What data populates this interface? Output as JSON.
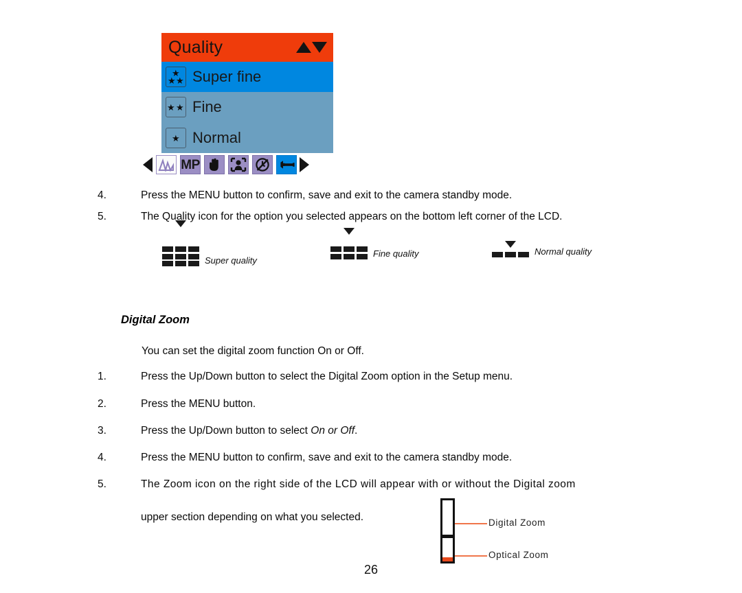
{
  "lcd_menu": {
    "title": "Quality",
    "header_color": "#EF3C0B",
    "selected_color": "#0087E0",
    "body_color": "#6B9FC0",
    "scroll_up_icon": "triangle-up-icon",
    "scroll_down_icon": "triangle-down-icon",
    "options": [
      {
        "label": "Super fine",
        "stars": 3,
        "selected": true
      },
      {
        "label": "Fine",
        "stars": 2,
        "selected": false
      },
      {
        "label": "Normal",
        "stars": 1,
        "selected": false
      }
    ]
  },
  "mode_toolbar": {
    "prev_icon": "arrow-left-icon",
    "next_icon": "arrow-right-icon",
    "items": [
      {
        "icon": "scene-histogram-icon",
        "label": "",
        "style": "white",
        "selected": false
      },
      {
        "icon": "megapixel-icon",
        "label": "MP",
        "style": "purple",
        "selected": false
      },
      {
        "icon": "hand-stabilizer-icon",
        "label": "",
        "style": "purple",
        "selected": false
      },
      {
        "icon": "face-detection-icon",
        "label": "",
        "style": "purple",
        "selected": false
      },
      {
        "icon": "self-timer-off-icon",
        "label": "",
        "style": "purple",
        "selected": false
      },
      {
        "icon": "wrench-setup-icon",
        "label": "",
        "style": "blue",
        "selected": true
      }
    ]
  },
  "steps_quality": [
    {
      "num": "4.",
      "text": "Press the MENU button to confirm, save and exit to the camera standby mode."
    },
    {
      "num": "5.",
      "text": "The Quality icon for the option you selected appears on the bottom left corner of the LCD."
    }
  ],
  "quality_icons": [
    {
      "icon": "super-quality-icon",
      "rows": 3,
      "label": "Super quality"
    },
    {
      "icon": "fine-quality-icon",
      "rows": 2,
      "label": "Fine quality"
    },
    {
      "icon": "normal-quality-icon",
      "rows": 1,
      "label": "Normal quality"
    }
  ],
  "digital_zoom": {
    "heading": "Digital Zoom",
    "intro": "You can set the digital zoom function On or Off.",
    "steps": [
      {
        "num": "1.",
        "text": "Press the Up/Down button to select the Digital Zoom option in the Setup menu."
      },
      {
        "num": "2.",
        "text": "Press the MENU button."
      },
      {
        "num": "3.",
        "pre": "Press the Up/Down button to select ",
        "em": "On or Off",
        "post": "."
      },
      {
        "num": "4.",
        "text": "Press the MENU button to confirm, save and exit to the camera standby mode."
      },
      {
        "num": "5.",
        "line1": "The Zoom icon on the right side of the LCD will appear with or without the Digital zoom",
        "line2": "upper section depending on what you selected."
      }
    ]
  },
  "zoom_diagram": {
    "digital_label": "Digital Zoom",
    "optical_label": "Optical Zoom",
    "fill_color": "#E8491C",
    "leader_color": "#F0754A"
  },
  "page": {
    "number": "26"
  }
}
